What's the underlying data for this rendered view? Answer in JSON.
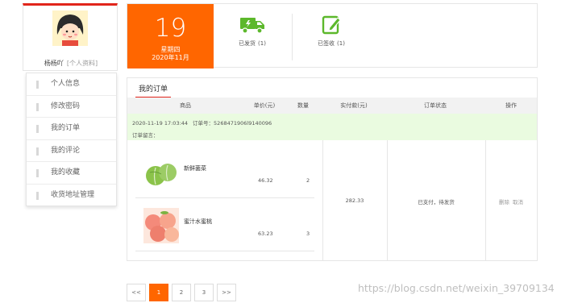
{
  "profile": {
    "username": "杨杨吖",
    "info_link": "[个人资料]",
    "avatar_icon": "cartoon-girl-avatar"
  },
  "sidebar": {
    "items": [
      {
        "label": "个人信息"
      },
      {
        "label": "修改密码"
      },
      {
        "label": "我的订单"
      },
      {
        "label": "我的评论"
      },
      {
        "label": "我的收藏"
      },
      {
        "label": "收货地址管理"
      }
    ]
  },
  "date": {
    "day": "19",
    "weekday": "星期四",
    "month": "2020年11月"
  },
  "stats": {
    "shipped": {
      "label": "已发货",
      "count": "(1)",
      "icon": "delivery-truck-icon"
    },
    "received": {
      "label": "已签收",
      "count": "(1)",
      "icon": "edit-check-icon"
    }
  },
  "orders": {
    "tab_label": "我的订单",
    "columns": [
      "商品",
      "单价(元)",
      "数量",
      "实付款(元)",
      "订单状态",
      "操作"
    ],
    "order": {
      "time": "2020-11-19 17:03:44",
      "order_no_label": "订单号：",
      "order_no": "5268471906l9140096",
      "message_label": "订单留言：",
      "total": "282.33",
      "status": "已支付，待发货",
      "actions": {
        "delete": "删除",
        "cancel": "取消"
      },
      "items": [
        {
          "name": "新鲜菌菜",
          "price": "46.32",
          "qty": "2"
        },
        {
          "name": "蜜汁水蜜桃",
          "price": "63.23",
          "qty": "3"
        }
      ]
    }
  },
  "pagination": {
    "prev": "<<",
    "pages": [
      "1",
      "2",
      "3"
    ],
    "next": ">>",
    "active": "1"
  },
  "watermark": "https://blog.csdn.net/weixin_39709134",
  "colors": {
    "accent": "#ff6600",
    "brand_red": "#e1251b",
    "icon_green": "#5cb82b",
    "info_row_bg": "#eafbe0"
  }
}
